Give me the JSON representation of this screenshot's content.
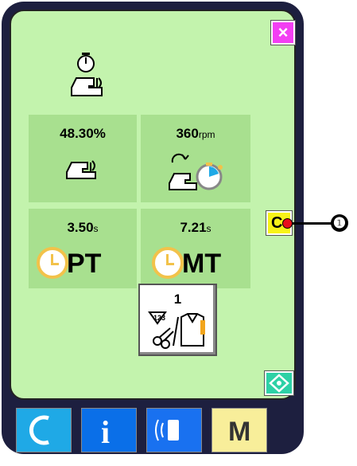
{
  "readings": {
    "stitch_rate": {
      "value": "48.30",
      "unit": "%"
    },
    "speed": {
      "value": "360",
      "unit": "rpm"
    },
    "pitch_time": {
      "value": "3.50",
      "unit": "s",
      "label": "PT"
    },
    "machine_time": {
      "value": "7.21",
      "unit": "s",
      "label": "MT"
    }
  },
  "counter": {
    "value": "1"
  },
  "buttons": {
    "close_symbol": "×",
    "clear_label": "C",
    "menu_label": "M",
    "info_label": "i"
  },
  "callout": {
    "number": "❶"
  },
  "colors": {
    "screen_bg": "#c3f3ad",
    "cell_bg": "#a8e08f",
    "close": "#f33ff3",
    "clear": "#f8f318",
    "start": "#2dd1a6",
    "bottom_ready": "#1fa9e6",
    "bottom_info": "#0a6fe8",
    "bottom_comm": "#1971f0",
    "bottom_menu": "#f8ee9a"
  },
  "icons": [
    "timer-sewing-machine-icon",
    "sewing-machine-icon",
    "speed-timer-icon",
    "clock-icon",
    "thread-trim-counter-icon",
    "start-icon",
    "ready-icon",
    "info-icon",
    "communication-icon"
  ]
}
